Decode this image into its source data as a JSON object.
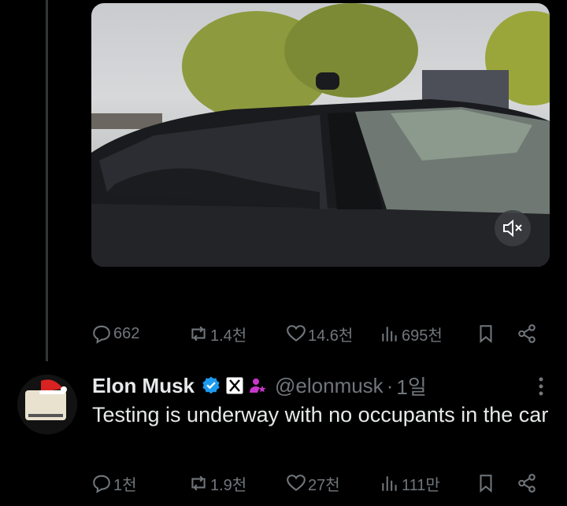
{
  "tweet1": {
    "actions": {
      "replies": "662",
      "reposts": "1.4천",
      "likes": "14.6천",
      "views": "695천"
    }
  },
  "reply": {
    "display_name": "Elon Musk",
    "handle": "@elonmusk",
    "separator": "·",
    "time": "1일",
    "text": "Testing is underway with no occupants in the car",
    "actions": {
      "replies": "1천",
      "reposts": "1.9천",
      "likes": "27천",
      "views": "111만"
    }
  },
  "colors": {
    "background": "#000000",
    "muted": "#71767b",
    "verified": "#1d9bf0",
    "affiliate": "#c936cc"
  },
  "icons": [
    "mute-icon",
    "reply-icon",
    "repost-icon",
    "like-icon",
    "views-icon",
    "bookmark-icon",
    "share-icon",
    "verified-icon",
    "x-badge-icon",
    "affiliate-icon",
    "more-icon"
  ]
}
